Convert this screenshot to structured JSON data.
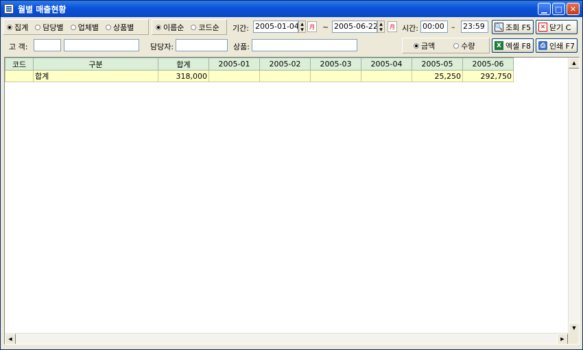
{
  "window": {
    "title": "월별 매출현황"
  },
  "group_mode": {
    "options": [
      "집계",
      "담당별",
      "업체별",
      "상품별"
    ],
    "selected": 0
  },
  "sort": {
    "options": [
      "이름순",
      "코드순"
    ],
    "selected": 0
  },
  "period": {
    "label": "기간:",
    "from": "2005-01-04",
    "separator": "~",
    "to": "2005-06-22"
  },
  "time": {
    "label": "시간:",
    "from": "00:00",
    "separator": "–",
    "to": "23:59"
  },
  "buttons": {
    "search": "조회 F5",
    "close": "닫기 C",
    "excel": "엑셀 F8",
    "print": "인쇄 F7"
  },
  "filters": {
    "customer_label": "고 객:",
    "customer_code": "",
    "customer_name": "",
    "manager_label": "담당자:",
    "manager_value": "",
    "product_label": "상품:",
    "product_value": ""
  },
  "measure": {
    "options": [
      "금액",
      "수량"
    ],
    "selected": 0
  },
  "grid": {
    "columns": [
      "코드",
      "구분",
      "합계",
      "2005-01",
      "2005-02",
      "2005-03",
      "2005-04",
      "2005-05",
      "2005-06"
    ],
    "rows": [
      [
        "",
        "합계",
        "318,000",
        "",
        "",
        "",
        "",
        "25,250",
        "292,750"
      ]
    ]
  }
}
